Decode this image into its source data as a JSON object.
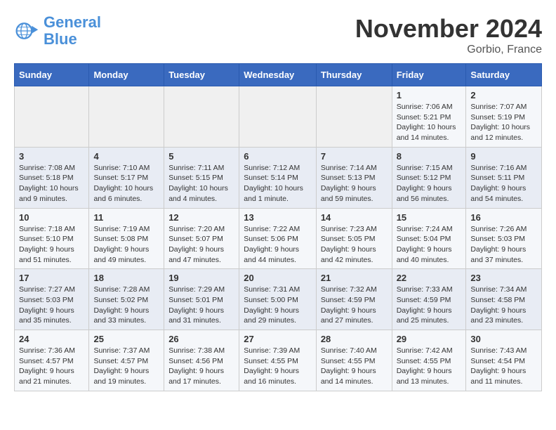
{
  "logo": {
    "text_general": "General",
    "text_blue": "Blue"
  },
  "title": "November 2024",
  "location": "Gorbio, France",
  "weekdays": [
    "Sunday",
    "Monday",
    "Tuesday",
    "Wednesday",
    "Thursday",
    "Friday",
    "Saturday"
  ],
  "weeks": [
    [
      {
        "day": "",
        "info": ""
      },
      {
        "day": "",
        "info": ""
      },
      {
        "day": "",
        "info": ""
      },
      {
        "day": "",
        "info": ""
      },
      {
        "day": "",
        "info": ""
      },
      {
        "day": "1",
        "info": "Sunrise: 7:06 AM\nSunset: 5:21 PM\nDaylight: 10 hours and 14 minutes."
      },
      {
        "day": "2",
        "info": "Sunrise: 7:07 AM\nSunset: 5:19 PM\nDaylight: 10 hours and 12 minutes."
      }
    ],
    [
      {
        "day": "3",
        "info": "Sunrise: 7:08 AM\nSunset: 5:18 PM\nDaylight: 10 hours and 9 minutes."
      },
      {
        "day": "4",
        "info": "Sunrise: 7:10 AM\nSunset: 5:17 PM\nDaylight: 10 hours and 6 minutes."
      },
      {
        "day": "5",
        "info": "Sunrise: 7:11 AM\nSunset: 5:15 PM\nDaylight: 10 hours and 4 minutes."
      },
      {
        "day": "6",
        "info": "Sunrise: 7:12 AM\nSunset: 5:14 PM\nDaylight: 10 hours and 1 minute."
      },
      {
        "day": "7",
        "info": "Sunrise: 7:14 AM\nSunset: 5:13 PM\nDaylight: 9 hours and 59 minutes."
      },
      {
        "day": "8",
        "info": "Sunrise: 7:15 AM\nSunset: 5:12 PM\nDaylight: 9 hours and 56 minutes."
      },
      {
        "day": "9",
        "info": "Sunrise: 7:16 AM\nSunset: 5:11 PM\nDaylight: 9 hours and 54 minutes."
      }
    ],
    [
      {
        "day": "10",
        "info": "Sunrise: 7:18 AM\nSunset: 5:10 PM\nDaylight: 9 hours and 51 minutes."
      },
      {
        "day": "11",
        "info": "Sunrise: 7:19 AM\nSunset: 5:08 PM\nDaylight: 9 hours and 49 minutes."
      },
      {
        "day": "12",
        "info": "Sunrise: 7:20 AM\nSunset: 5:07 PM\nDaylight: 9 hours and 47 minutes."
      },
      {
        "day": "13",
        "info": "Sunrise: 7:22 AM\nSunset: 5:06 PM\nDaylight: 9 hours and 44 minutes."
      },
      {
        "day": "14",
        "info": "Sunrise: 7:23 AM\nSunset: 5:05 PM\nDaylight: 9 hours and 42 minutes."
      },
      {
        "day": "15",
        "info": "Sunrise: 7:24 AM\nSunset: 5:04 PM\nDaylight: 9 hours and 40 minutes."
      },
      {
        "day": "16",
        "info": "Sunrise: 7:26 AM\nSunset: 5:03 PM\nDaylight: 9 hours and 37 minutes."
      }
    ],
    [
      {
        "day": "17",
        "info": "Sunrise: 7:27 AM\nSunset: 5:03 PM\nDaylight: 9 hours and 35 minutes."
      },
      {
        "day": "18",
        "info": "Sunrise: 7:28 AM\nSunset: 5:02 PM\nDaylight: 9 hours and 33 minutes."
      },
      {
        "day": "19",
        "info": "Sunrise: 7:29 AM\nSunset: 5:01 PM\nDaylight: 9 hours and 31 minutes."
      },
      {
        "day": "20",
        "info": "Sunrise: 7:31 AM\nSunset: 5:00 PM\nDaylight: 9 hours and 29 minutes."
      },
      {
        "day": "21",
        "info": "Sunrise: 7:32 AM\nSunset: 4:59 PM\nDaylight: 9 hours and 27 minutes."
      },
      {
        "day": "22",
        "info": "Sunrise: 7:33 AM\nSunset: 4:59 PM\nDaylight: 9 hours and 25 minutes."
      },
      {
        "day": "23",
        "info": "Sunrise: 7:34 AM\nSunset: 4:58 PM\nDaylight: 9 hours and 23 minutes."
      }
    ],
    [
      {
        "day": "24",
        "info": "Sunrise: 7:36 AM\nSunset: 4:57 PM\nDaylight: 9 hours and 21 minutes."
      },
      {
        "day": "25",
        "info": "Sunrise: 7:37 AM\nSunset: 4:57 PM\nDaylight: 9 hours and 19 minutes."
      },
      {
        "day": "26",
        "info": "Sunrise: 7:38 AM\nSunset: 4:56 PM\nDaylight: 9 hours and 17 minutes."
      },
      {
        "day": "27",
        "info": "Sunrise: 7:39 AM\nSunset: 4:55 PM\nDaylight: 9 hours and 16 minutes."
      },
      {
        "day": "28",
        "info": "Sunrise: 7:40 AM\nSunset: 4:55 PM\nDaylight: 9 hours and 14 minutes."
      },
      {
        "day": "29",
        "info": "Sunrise: 7:42 AM\nSunset: 4:55 PM\nDaylight: 9 hours and 13 minutes."
      },
      {
        "day": "30",
        "info": "Sunrise: 7:43 AM\nSunset: 4:54 PM\nDaylight: 9 hours and 11 minutes."
      }
    ]
  ]
}
